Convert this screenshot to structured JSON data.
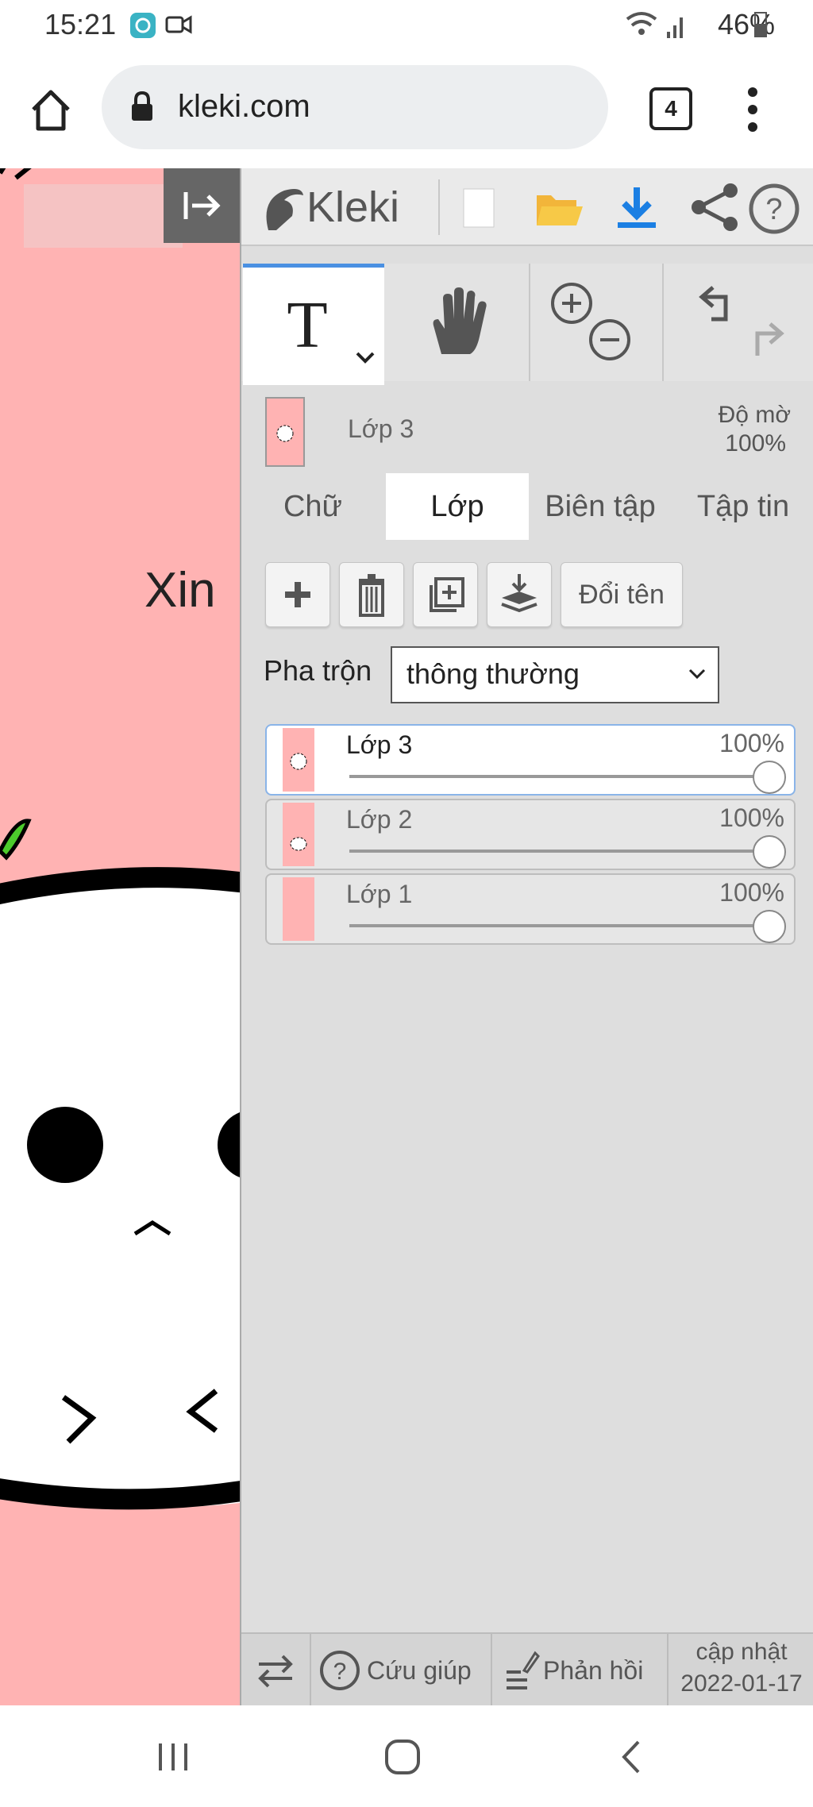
{
  "status": {
    "time": "15:21",
    "battery": "46%"
  },
  "browser": {
    "url": "kleki.com",
    "tab_count": "4"
  },
  "canvas": {
    "text_fragment": "Xin",
    "bg_color": "#ffb3b3"
  },
  "app": {
    "name": "Kleki"
  },
  "layer_info": {
    "current": "Lớp 3",
    "opacity_label": "Độ mờ",
    "opacity_value": "100%"
  },
  "tabs": [
    "Chữ",
    "Lớp",
    "Biên tập",
    "Tập tin"
  ],
  "layer_actions": {
    "rename": "Đổi tên"
  },
  "blend": {
    "label": "Pha trộn",
    "value": "thông thường"
  },
  "layers": [
    {
      "name": "Lớp 3",
      "opacity": "100%"
    },
    {
      "name": "Lớp 2",
      "opacity": "100%"
    },
    {
      "name": "Lớp 1",
      "opacity": "100%"
    }
  ],
  "footer": {
    "help": "Cứu giúp",
    "feedback": "Phản hồi",
    "update_label": "cập nhật",
    "update_date": "2022-01-17"
  }
}
